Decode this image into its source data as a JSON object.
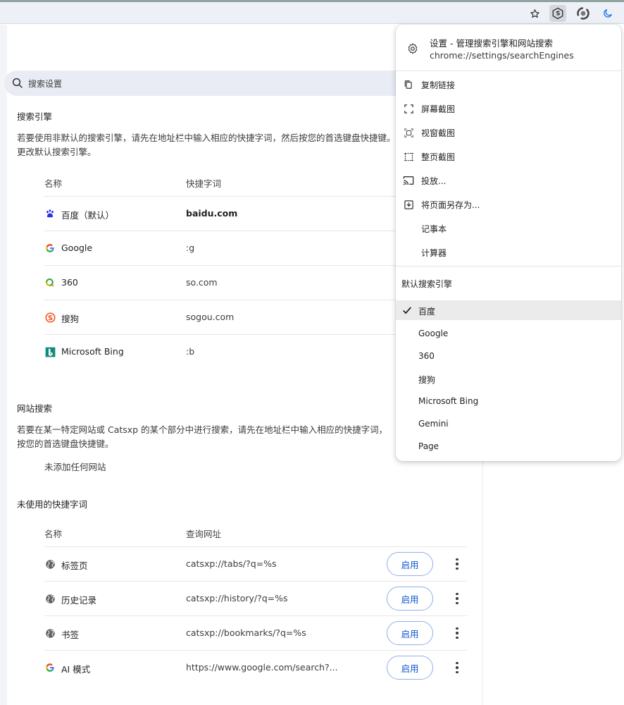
{
  "toolbar": {
    "icons": [
      "star-icon",
      "extension-s-icon",
      "sync-icon",
      "moon-icon"
    ]
  },
  "search": {
    "placeholder": "搜索设置"
  },
  "search_engines": {
    "title": "搜索引擎",
    "description": "若要使用非默认的搜索引擎，请先在地址栏中输入相应的快捷字词，然后按您的首选键盘快捷键。您也可以在这里更改默认搜索引擎。",
    "description_visible": "若要使用非默认的搜索引擎，请先在地址栏中输入相应的快捷字词，然后按您的首选键盘快捷键。",
    "description_line2": "更改默认搜索引擎。",
    "col_name": "名称",
    "col_keyword": "快捷字词",
    "rows": [
      {
        "name": "百度（默认）",
        "keyword": "baidu.com",
        "icon": "baidu-icon"
      },
      {
        "name": "Google",
        "keyword": ":g",
        "icon": "google-icon"
      },
      {
        "name": "360",
        "keyword": "so.com",
        "icon": "360-icon"
      },
      {
        "name": "搜狗",
        "keyword": "sogou.com",
        "icon": "sogou-icon"
      },
      {
        "name": "Microsoft Bing",
        "keyword": ":b",
        "icon": "bing-icon"
      }
    ]
  },
  "site_search": {
    "title": "网站搜索",
    "description_line1": "若要在某一特定网站或 Catsxp 的某个部分中进行搜索，请先在地址栏中输入相应的快捷字词，",
    "description_line2": "按您的首选键盘快捷键。",
    "empty": "未添加任何网站"
  },
  "inactive": {
    "title": "未使用的快捷字词",
    "col_name": "名称",
    "col_url": "查询网址",
    "enable_label": "启用",
    "rows": [
      {
        "name": "标签页",
        "url": "catsxp://tabs/?q=%s",
        "icon": "globe-icon"
      },
      {
        "name": "历史记录",
        "url": "catsxp://history/?q=%s",
        "icon": "globe-icon"
      },
      {
        "name": "书签",
        "url": "catsxp://bookmarks/?q=%s",
        "icon": "globe-icon"
      },
      {
        "name": "AI 模式",
        "url": "https://www.google.com/search?...",
        "icon": "google-icon"
      }
    ]
  },
  "menu": {
    "header_title": "设置 - 管理搜索引擎和网站搜索",
    "header_url": "chrome://settings/searchEngines",
    "items": [
      {
        "label": "复制链接",
        "icon": "copy-icon"
      },
      {
        "label": "屏幕截图",
        "icon": "screenshot-icon"
      },
      {
        "label": "视窗截图",
        "icon": "window-capture-icon"
      },
      {
        "label": "整页截图",
        "icon": "fullpage-capture-icon"
      },
      {
        "label": "投放...",
        "icon": "cast-icon"
      },
      {
        "label": "将页面另存为...",
        "icon": "save-page-icon"
      },
      {
        "label": "记事本",
        "icon": ""
      },
      {
        "label": "计算器",
        "icon": ""
      }
    ],
    "engines_title": "默认搜索引擎",
    "engines": [
      {
        "label": "百度",
        "selected": true
      },
      {
        "label": "Google",
        "selected": false
      },
      {
        "label": "360",
        "selected": false
      },
      {
        "label": "搜狗",
        "selected": false
      },
      {
        "label": "Microsoft Bing",
        "selected": false
      },
      {
        "label": "Gemini",
        "selected": false
      },
      {
        "label": "Page",
        "selected": false
      }
    ]
  },
  "colors": {
    "accent": "#0b57d0",
    "toolbar_bg": "#eef0f8",
    "search_bg": "#e9ecf5"
  }
}
